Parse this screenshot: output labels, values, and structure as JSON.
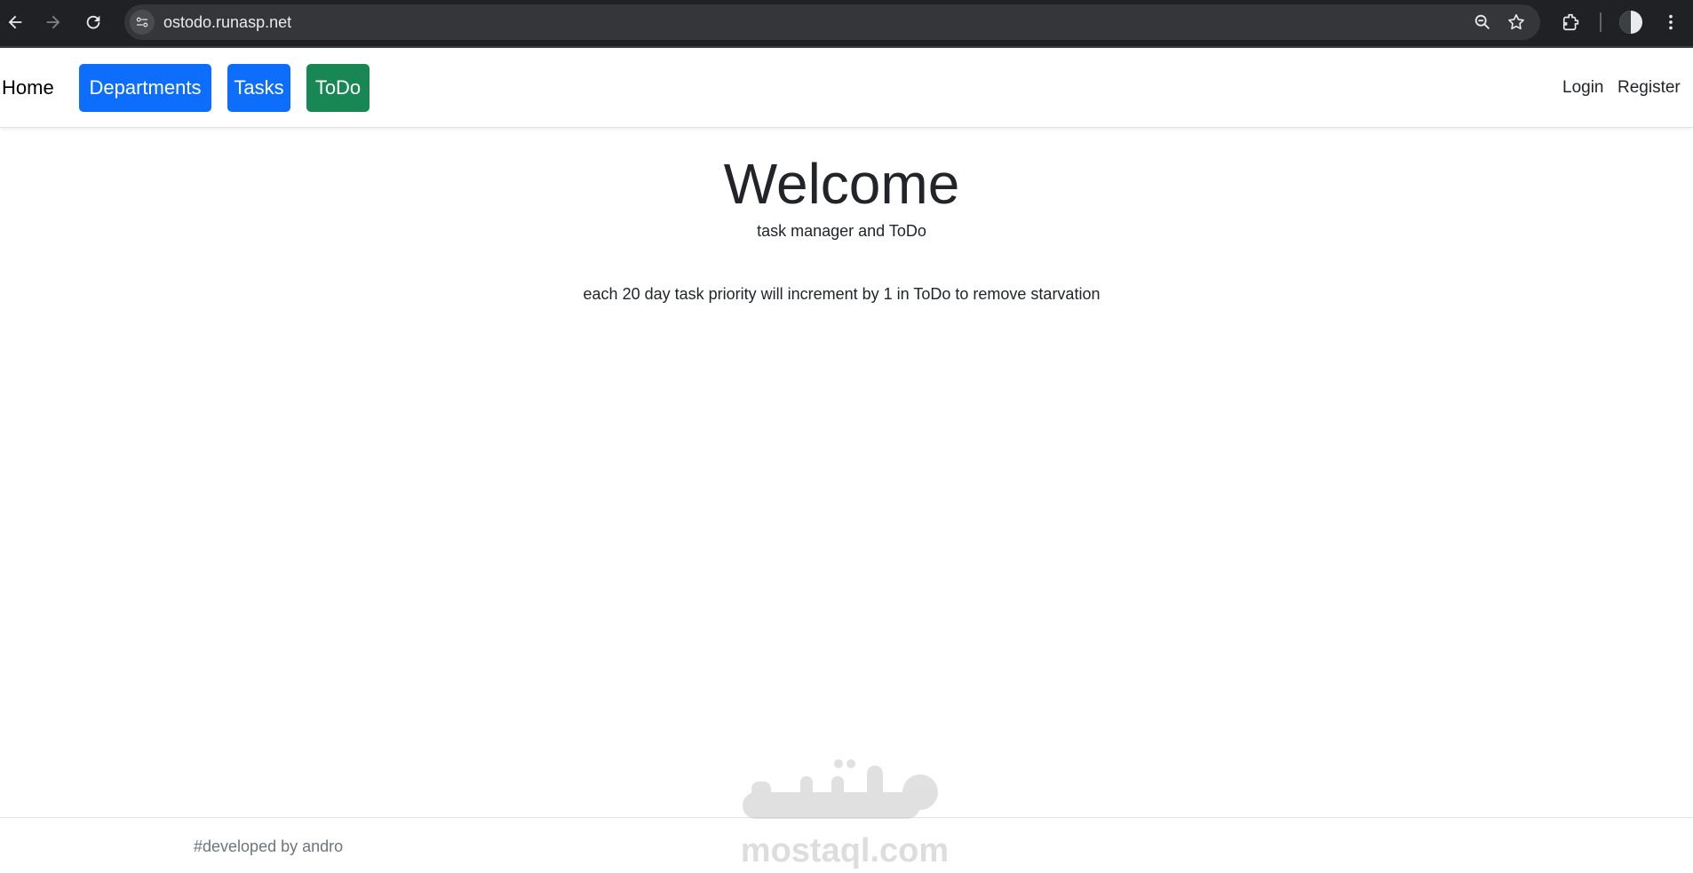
{
  "browser": {
    "url": "ostodo.runasp.net",
    "icons": [
      "back-arrow-icon",
      "forward-arrow-icon",
      "reload-icon",
      "site-settings-icon",
      "zoom-icon",
      "bookmark-star-icon",
      "extensions-icon",
      "profile-avatar-icon",
      "menu-kebab-icon"
    ]
  },
  "navbar": {
    "home": "Home",
    "buttons": [
      {
        "label": "Departments",
        "color": "#0d6efd"
      },
      {
        "label": "Tasks",
        "color": "#0d6efd"
      },
      {
        "label": "ToDo",
        "color": "#198754"
      }
    ],
    "login": "Login",
    "register": "Register"
  },
  "main": {
    "title": "Welcome",
    "subtitle": "task manager and ToDo",
    "note": "each 20 day task priority will increment by 1 in ToDo to remove starvation"
  },
  "footer": {
    "text": "#developed by andro"
  },
  "watermark": {
    "arabic": "مستقل",
    "latin": "mostaql.com"
  }
}
